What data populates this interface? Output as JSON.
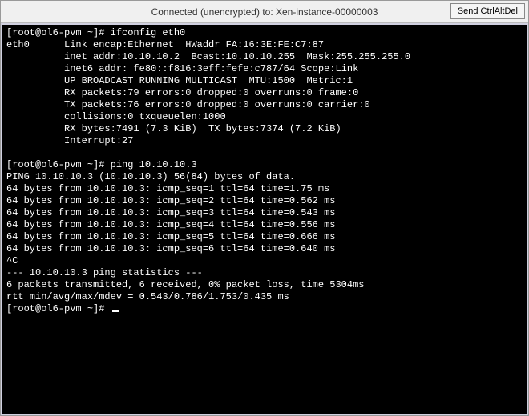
{
  "titlebar": {
    "title": "Connected (unencrypted) to: Xen-instance-00000003",
    "ctrlaltdel_label": "Send CtrlAltDel"
  },
  "terminal": {
    "lines": [
      "[root@ol6-pvm ~]# ifconfig eth0",
      "eth0      Link encap:Ethernet  HWaddr FA:16:3E:FE:C7:87",
      "          inet addr:10.10.10.2  Bcast:10.10.10.255  Mask:255.255.255.0",
      "          inet6 addr: fe80::f816:3eff:fefe:c787/64 Scope:Link",
      "          UP BROADCAST RUNNING MULTICAST  MTU:1500  Metric:1",
      "          RX packets:79 errors:0 dropped:0 overruns:0 frame:0",
      "          TX packets:76 errors:0 dropped:0 overruns:0 carrier:0",
      "          collisions:0 txqueuelen:1000",
      "          RX bytes:7491 (7.3 KiB)  TX bytes:7374 (7.2 KiB)",
      "          Interrupt:27",
      "",
      "[root@ol6-pvm ~]# ping 10.10.10.3",
      "PING 10.10.10.3 (10.10.10.3) 56(84) bytes of data.",
      "64 bytes from 10.10.10.3: icmp_seq=1 ttl=64 time=1.75 ms",
      "64 bytes from 10.10.10.3: icmp_seq=2 ttl=64 time=0.562 ms",
      "64 bytes from 10.10.10.3: icmp_seq=3 ttl=64 time=0.543 ms",
      "64 bytes from 10.10.10.3: icmp_seq=4 ttl=64 time=0.556 ms",
      "64 bytes from 10.10.10.3: icmp_seq=5 ttl=64 time=0.666 ms",
      "64 bytes from 10.10.10.3: icmp_seq=6 ttl=64 time=0.640 ms",
      "^C",
      "--- 10.10.10.3 ping statistics ---",
      "6 packets transmitted, 6 received, 0% packet loss, time 5304ms",
      "rtt min/avg/max/mdev = 0.543/0.786/1.753/0.435 ms",
      "[root@ol6-pvm ~]# "
    ]
  }
}
